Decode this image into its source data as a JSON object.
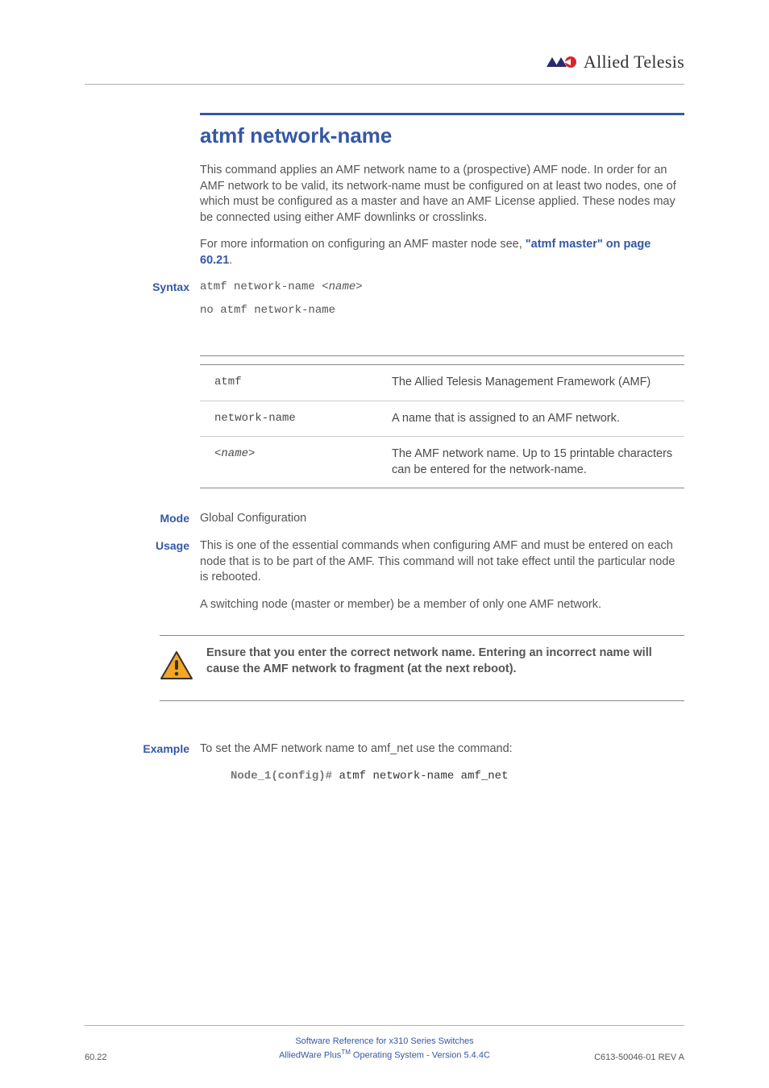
{
  "header": {
    "brand": "Allied Telesis"
  },
  "title": "atmf network-name",
  "intro": {
    "p1": "This command applies an AMF network name to a (prospective) AMF node. In order for an AMF network to be valid, its network-name must be configured on at least two nodes, one of which must be configured as a master and have an AMF License applied. These nodes may be connected using either AMF downlinks or crosslinks.",
    "p2_prefix": "For more information on configuring an AMF master node see, ",
    "p2_link": "\"atmf master\" on page 60.21",
    "p2_suffix": "."
  },
  "syntax": {
    "label": "Syntax",
    "line1_prefix": "atmf network-name <",
    "line1_param": "name",
    "line1_suffix": ">",
    "line2": "no atmf network-name"
  },
  "params": [
    {
      "name": "atmf",
      "italic": false,
      "desc": "The Allied Telesis Management Framework (AMF)"
    },
    {
      "name": "network-name",
      "italic": false,
      "desc": "A name that is assigned to an AMF network."
    },
    {
      "name": "<name>",
      "italic": true,
      "desc": "The AMF network name. Up to 15 printable characters can be entered for the network-name."
    }
  ],
  "mode": {
    "label": "Mode",
    "text": "Global Configuration"
  },
  "usage": {
    "label": "Usage",
    "p1": "This is one of the essential commands when configuring AMF and must be entered on each node that is to be part of the AMF. This command will not take effect until the particular node is rebooted.",
    "p2": "A switching node (master or member) be a member of only one AMF network."
  },
  "caution": {
    "text": "Ensure that you enter the correct network name. Entering an incorrect name will cause the AMF network to fragment (at the next reboot)."
  },
  "example": {
    "label": "Example",
    "intro": "To set the AMF network name to amf_net use the command:",
    "prompt": "Node_1(config)#",
    "command": "atmf network-name amf_net"
  },
  "footer": {
    "left": "60.22",
    "center_line1": "Software Reference for x310 Series Switches",
    "center_line2_prefix": "AlliedWare Plus",
    "center_line2_tm": "TM",
    "center_line2_suffix": " Operating System  - Version 5.4.4C",
    "right": "C613-50046-01 REV A"
  }
}
